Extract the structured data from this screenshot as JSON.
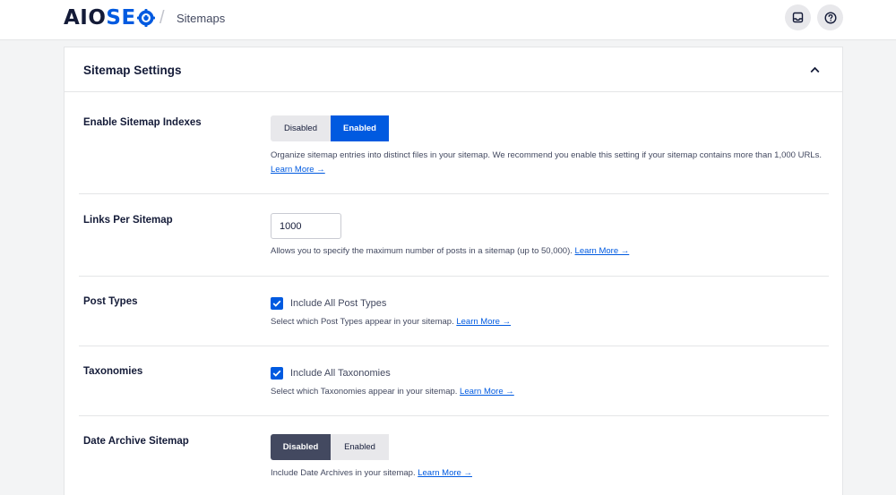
{
  "header": {
    "logo_prefix": "AIO",
    "logo_suffix_s": "S",
    "logo_suffix_o": "O",
    "separator": "/",
    "page_title": "Sitemaps",
    "icons": [
      "inbox-icon",
      "help-icon"
    ]
  },
  "colors": {
    "brand_blue": "#005ae0",
    "dark": "#141b38",
    "muted": "#434960"
  },
  "card": {
    "title": "Sitemap Settings"
  },
  "settings": {
    "sitemap_indexes": {
      "label": "Enable Sitemap Indexes",
      "options": [
        "Disabled",
        "Enabled"
      ],
      "selected": "Enabled",
      "description": "Organize sitemap entries into distinct files in your sitemap. We recommend you enable this setting if your sitemap contains more than 1,000 URLs.",
      "learn_more": "Learn More →"
    },
    "links_per_sitemap": {
      "label": "Links Per Sitemap",
      "value": "1000",
      "description": "Allows you to specify the maximum number of posts in a sitemap (up to 50,000).",
      "learn_more": "Learn More →"
    },
    "post_types": {
      "label": "Post Types",
      "checkbox_label": "Include All Post Types",
      "checked": true,
      "description": "Select which Post Types appear in your sitemap.",
      "learn_more": "Learn More →"
    },
    "taxonomies": {
      "label": "Taxonomies",
      "checkbox_label": "Include All Taxonomies",
      "checked": true,
      "description": "Select which Taxonomies appear in your sitemap.",
      "learn_more": "Learn More →"
    },
    "date_archive": {
      "label": "Date Archive Sitemap",
      "options": [
        "Disabled",
        "Enabled"
      ],
      "selected": "Disabled",
      "description": "Include Date Archives in your sitemap.",
      "learn_more": "Learn More →"
    }
  }
}
